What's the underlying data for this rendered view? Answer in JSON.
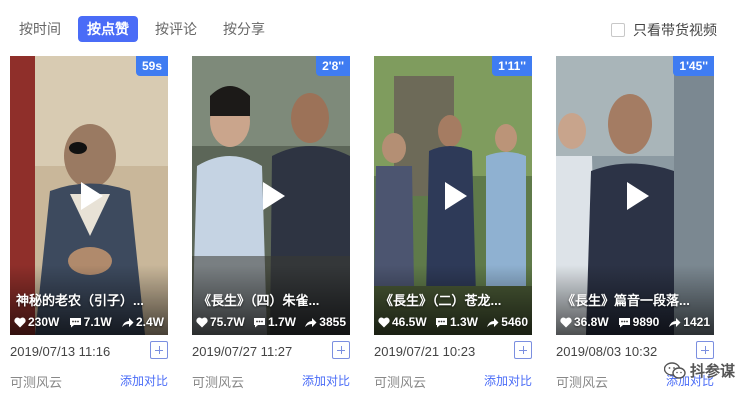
{
  "tabs": [
    {
      "label": "按时间",
      "active": false
    },
    {
      "label": "按点赞",
      "active": true
    },
    {
      "label": "按评论",
      "active": false
    },
    {
      "label": "按分享",
      "active": false
    }
  ],
  "filter": {
    "label": "只看带货视频",
    "checked": false
  },
  "cards": [
    {
      "duration": "59s",
      "title": "神秘的老农（引子）...",
      "likes": "230W",
      "comments": "7.1W",
      "shares": "2.4W",
      "date": "2019/07/13 11:16",
      "author": "可测风云",
      "compare_label": "添加对比"
    },
    {
      "duration": "2'8''",
      "title": "《長生》（四）朱雀...",
      "likes": "75.7W",
      "comments": "1.7W",
      "shares": "3855",
      "date": "2019/07/27 11:27",
      "author": "可测风云",
      "compare_label": "添加对比"
    },
    {
      "duration": "1'11''",
      "title": "《長生》（二）苍龙...",
      "likes": "46.5W",
      "comments": "1.3W",
      "shares": "5460",
      "date": "2019/07/21 10:23",
      "author": "可测风云",
      "compare_label": "添加对比"
    },
    {
      "duration": "1'45''",
      "title": "《長生》篇音一段落...",
      "likes": "36.8W",
      "comments": "9890",
      "shares": "1421",
      "date": "2019/08/03 10:32",
      "author": "可测风云",
      "compare_label": "添加对比"
    }
  ],
  "logo": {
    "text": "抖参谋",
    "icon": "wechat-icon"
  },
  "colors": {
    "accent": "#4a6cf7",
    "duration_badge": "#3f7cf2"
  }
}
